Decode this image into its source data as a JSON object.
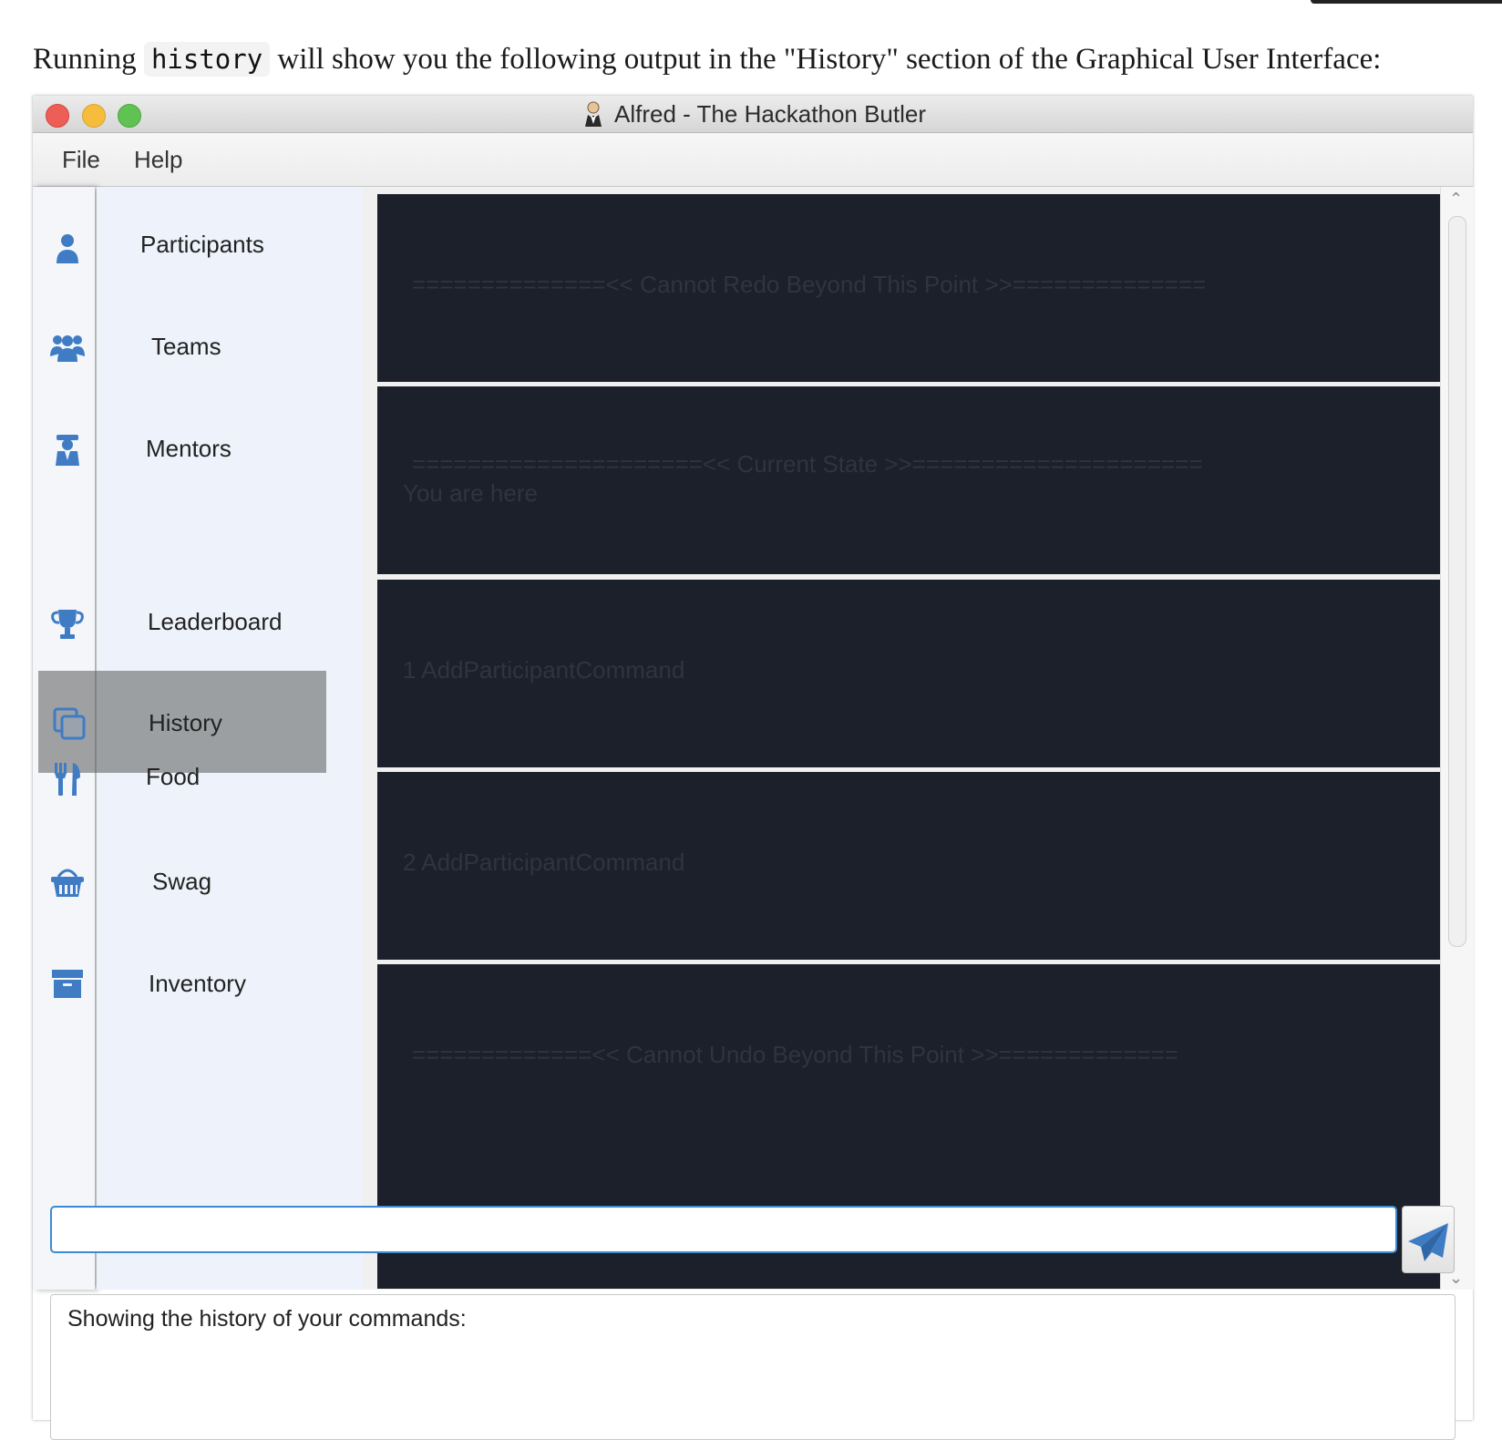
{
  "intro": {
    "before": "Running ",
    "code": "history",
    "after": " will show you the following output in the \"History\" section of the Graphical User Interface:"
  },
  "window": {
    "title": "Alfred - The Hackathon Butler",
    "title_icon": "butler-icon",
    "traffic_lights": [
      "#ed5f56",
      "#f5bd3b",
      "#5fc253"
    ]
  },
  "menu": {
    "file": "File",
    "help": "Help"
  },
  "sidebar": {
    "items": [
      {
        "label": "Participants",
        "icon": "person-icon"
      },
      {
        "label": "Teams",
        "icon": "group-icon"
      },
      {
        "label": "Mentors",
        "icon": "mentor-icon"
      },
      {
        "label": "Leaderboard",
        "icon": "trophy-icon"
      },
      {
        "label": "History",
        "icon": "history-icon"
      },
      {
        "label": "Food",
        "icon": "cutlery-icon"
      },
      {
        "label": "Swag",
        "icon": "basket-icon"
      },
      {
        "label": "Inventory",
        "icon": "archive-icon"
      }
    ],
    "active": "History",
    "icon_color": "#3f7cc4"
  },
  "history": {
    "cards": [
      {
        "lines": [
          "==============<< Cannot Redo Beyond This Point >>=============="
        ]
      },
      {
        "lines": [
          "=====================<< Current State >>=====================",
          "You are here"
        ]
      },
      {
        "lines": [
          "1  AddParticipantCommand"
        ]
      },
      {
        "lines": [
          "2  AddParticipantCommand"
        ]
      },
      {
        "lines": [
          "=============<< Cannot Undo Beyond This Point >>============="
        ]
      }
    ],
    "card_color": "#1c202a"
  },
  "command_box": {
    "value": "",
    "placeholder": ""
  },
  "result": {
    "text": "Showing the history of your commands:"
  }
}
